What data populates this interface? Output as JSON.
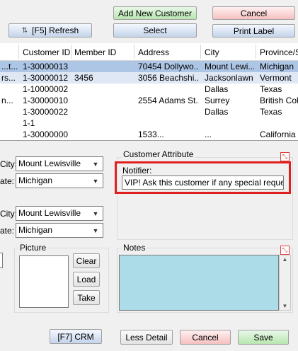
{
  "toolbar": {
    "add_new_customer": "Add New Customer",
    "cancel": "Cancel",
    "refresh": "[F5] Refresh",
    "select": "Select",
    "print_label": "Print Label"
  },
  "grid": {
    "columns": [
      "Customer ID",
      "Member ID",
      "Address",
      "City",
      "Province/St"
    ],
    "rows": [
      {
        "name": "...t...",
        "customer_id": "1-30000013",
        "member_id": "",
        "address": "70454 Dollywo...",
        "city": "Mount Lewi...",
        "province": "Michigan"
      },
      {
        "name": "rs...",
        "customer_id": "1-30000012",
        "member_id": "3456",
        "address": "3056 Beachshi...",
        "city": "Jacksonlawn",
        "province": "Vermont"
      },
      {
        "name": "",
        "customer_id": "1-10000002",
        "member_id": "",
        "address": "",
        "city": "Dallas",
        "province": "Texas"
      },
      {
        "name": "n...",
        "customer_id": "1-30000010",
        "member_id": "",
        "address": "2554 Adams St...",
        "city": "Surrey",
        "province": "British Colum"
      },
      {
        "name": "",
        "customer_id": "1-30000022",
        "member_id": "",
        "address": "",
        "city": "Dallas",
        "province": "Texas"
      },
      {
        "name": "",
        "customer_id": "1-1",
        "member_id": "",
        "address": "",
        "city": "",
        "province": ""
      },
      {
        "name": "",
        "customer_id": "1-30000000",
        "member_id": "",
        "address": "1533...",
        "city": "...",
        "province": "California"
      }
    ]
  },
  "address1": {
    "city_label": "City:",
    "city_value": "Mount Lewisville",
    "state_label": "ate:",
    "state_value": "Michigan"
  },
  "address2": {
    "city_label": "City:",
    "city_value": "Mount Lewisville",
    "state_label": "ate:",
    "state_value": "Michigan"
  },
  "customer_attribute": {
    "title": "Customer Attribute",
    "notifier_label": "Notifier:",
    "notifier_value": "VIP! Ask this customer if any special request!"
  },
  "picture": {
    "title": "Picture",
    "clear": "Clear",
    "load": "Load",
    "take": "Take"
  },
  "notes": {
    "title": "Notes",
    "value": ""
  },
  "footer": {
    "crm": "[F7] CRM",
    "less_detail": "Less Detail",
    "cancel": "Cancel",
    "save": "Save"
  },
  "colors": {
    "selected_row": "#aec6e6",
    "highlight_border": "#e02020",
    "notes_bg": "#acdce8"
  }
}
